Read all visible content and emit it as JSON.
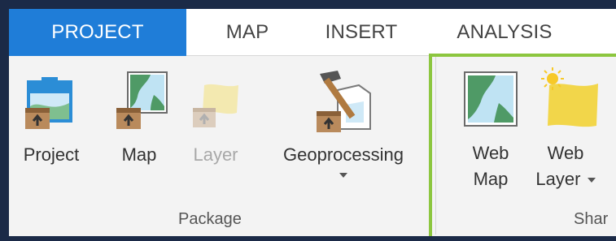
{
  "tabs": [
    {
      "label": "PROJECT",
      "active": true
    },
    {
      "label": "MAP",
      "active": false
    },
    {
      "label": "INSERT",
      "active": false
    },
    {
      "label": "ANALYSIS",
      "active": false
    }
  ],
  "package_group": {
    "label": "Package",
    "commands": [
      {
        "label": "Project",
        "icon": "package-project-icon",
        "enabled": true
      },
      {
        "label": "Map",
        "icon": "package-map-icon",
        "enabled": true
      },
      {
        "label": "Layer",
        "icon": "package-layer-icon",
        "enabled": false
      },
      {
        "label": "Geoprocessing",
        "icon": "package-geoprocessing-icon",
        "enabled": true
      }
    ]
  },
  "share_group": {
    "label": "Shar",
    "commands": [
      {
        "label_line1": "Web",
        "label_line2": "Map",
        "icon": "web-map-icon"
      },
      {
        "label_line1": "Web",
        "label_line2": "Layer",
        "icon": "web-layer-icon"
      }
    ]
  },
  "colors": {
    "active_tab": "#1f7dd8",
    "highlight_border": "#8cc63f",
    "frame": "#1b2a47"
  }
}
